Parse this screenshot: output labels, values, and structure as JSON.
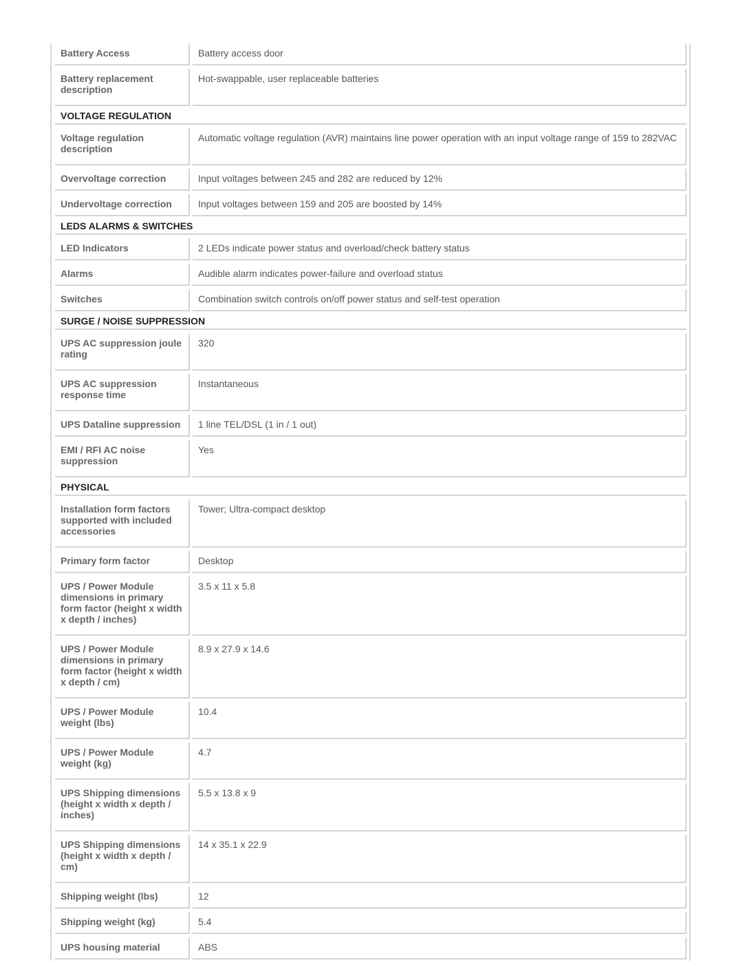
{
  "rows": [
    {
      "type": "row",
      "label": "Battery Access",
      "value": "Battery access door"
    },
    {
      "type": "row",
      "label": "Battery replacement description",
      "value": "Hot-swappable, user replaceable batteries"
    },
    {
      "type": "section",
      "label": "VOLTAGE REGULATION"
    },
    {
      "type": "row",
      "label": "Voltage regulation description",
      "value": "Automatic voltage regulation (AVR) maintains line power operation with an input voltage range of 159 to 282VAC"
    },
    {
      "type": "row",
      "label": "Overvoltage correction",
      "value": "Input voltages between 245 and 282 are reduced by 12%"
    },
    {
      "type": "row",
      "label": "Undervoltage correction",
      "value": "Input voltages between 159 and 205 are boosted by 14%"
    },
    {
      "type": "section",
      "label": "LEDS ALARMS & SWITCHES"
    },
    {
      "type": "row",
      "label": "LED Indicators",
      "value": "2 LEDs indicate power status and overload/check battery status"
    },
    {
      "type": "row",
      "label": "Alarms",
      "value": "Audible alarm indicates power-failure and overload status"
    },
    {
      "type": "row",
      "label": "Switches",
      "value": "Combination switch controls on/off power status and self-test operation"
    },
    {
      "type": "section",
      "label": "SURGE / NOISE SUPPRESSION"
    },
    {
      "type": "row",
      "label": "UPS AC suppression joule rating",
      "value": "320"
    },
    {
      "type": "row",
      "label": "UPS AC suppression response time",
      "value": "Instantaneous"
    },
    {
      "type": "row",
      "label": "UPS Dataline suppression",
      "value": "1 line TEL/DSL (1 in / 1 out)"
    },
    {
      "type": "row",
      "label": "EMI / RFI AC noise suppression",
      "value": "Yes"
    },
    {
      "type": "section",
      "label": "PHYSICAL"
    },
    {
      "type": "row",
      "label": "Installation form factors supported with included accessories",
      "value": "Tower; Ultra-compact desktop"
    },
    {
      "type": "row",
      "label": "Primary form factor",
      "value": "Desktop"
    },
    {
      "type": "row",
      "label": "UPS / Power Module dimensions in primary form factor (height x width x depth / inches)",
      "value": "3.5 x 11 x 5.8"
    },
    {
      "type": "row",
      "label": "UPS / Power Module dimensions in primary form factor (height x width x depth / cm)",
      "value": "8.9 x 27.9 x 14.6"
    },
    {
      "type": "row",
      "label": "UPS / Power Module weight (lbs)",
      "value": "10.4"
    },
    {
      "type": "row",
      "label": "UPS / Power Module weight (kg)",
      "value": "4.7"
    },
    {
      "type": "row",
      "label": "UPS Shipping dimensions (height x width x depth / inches)",
      "value": "5.5 x 13.8 x 9"
    },
    {
      "type": "row",
      "label": "UPS Shipping dimensions (height x width x depth / cm)",
      "value": "14 x 35.1 x 22.9"
    },
    {
      "type": "row",
      "label": "Shipping weight (lbs)",
      "value": "12"
    },
    {
      "type": "row",
      "label": "Shipping weight (kg)",
      "value": "5.4"
    },
    {
      "type": "row",
      "label": "UPS housing material",
      "value": "ABS"
    }
  ]
}
